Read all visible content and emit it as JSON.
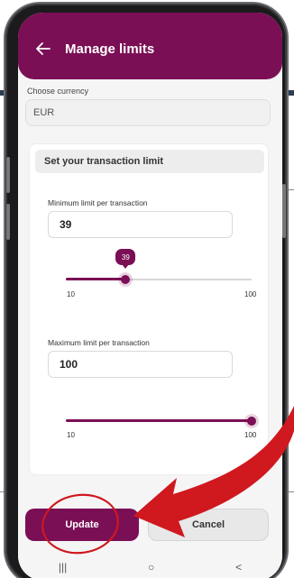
{
  "header": {
    "title": "Manage limits"
  },
  "currency": {
    "label": "Choose currency",
    "value": "EUR"
  },
  "limits_card": {
    "title": "Set your transaction limit",
    "min": {
      "label": "Minimum limit per transaction",
      "value": "39",
      "slider_value": 39,
      "tooltip": "39",
      "range_min": 10,
      "range_max": 100,
      "tick_min": "10",
      "tick_max": "100"
    },
    "max": {
      "label": "Maximum limit per transaction",
      "value": "100",
      "slider_value": 100,
      "range_min": 10,
      "range_max": 100,
      "tick_min": "10",
      "tick_max": "100"
    }
  },
  "actions": {
    "update_label": "Update",
    "cancel_label": "Cancel"
  },
  "nav": {
    "recents": "|||",
    "home": "○",
    "back": "<"
  },
  "colors": {
    "primary": "#7b0f55",
    "annotation": "#d0181f",
    "background": "#f5f5f5"
  }
}
